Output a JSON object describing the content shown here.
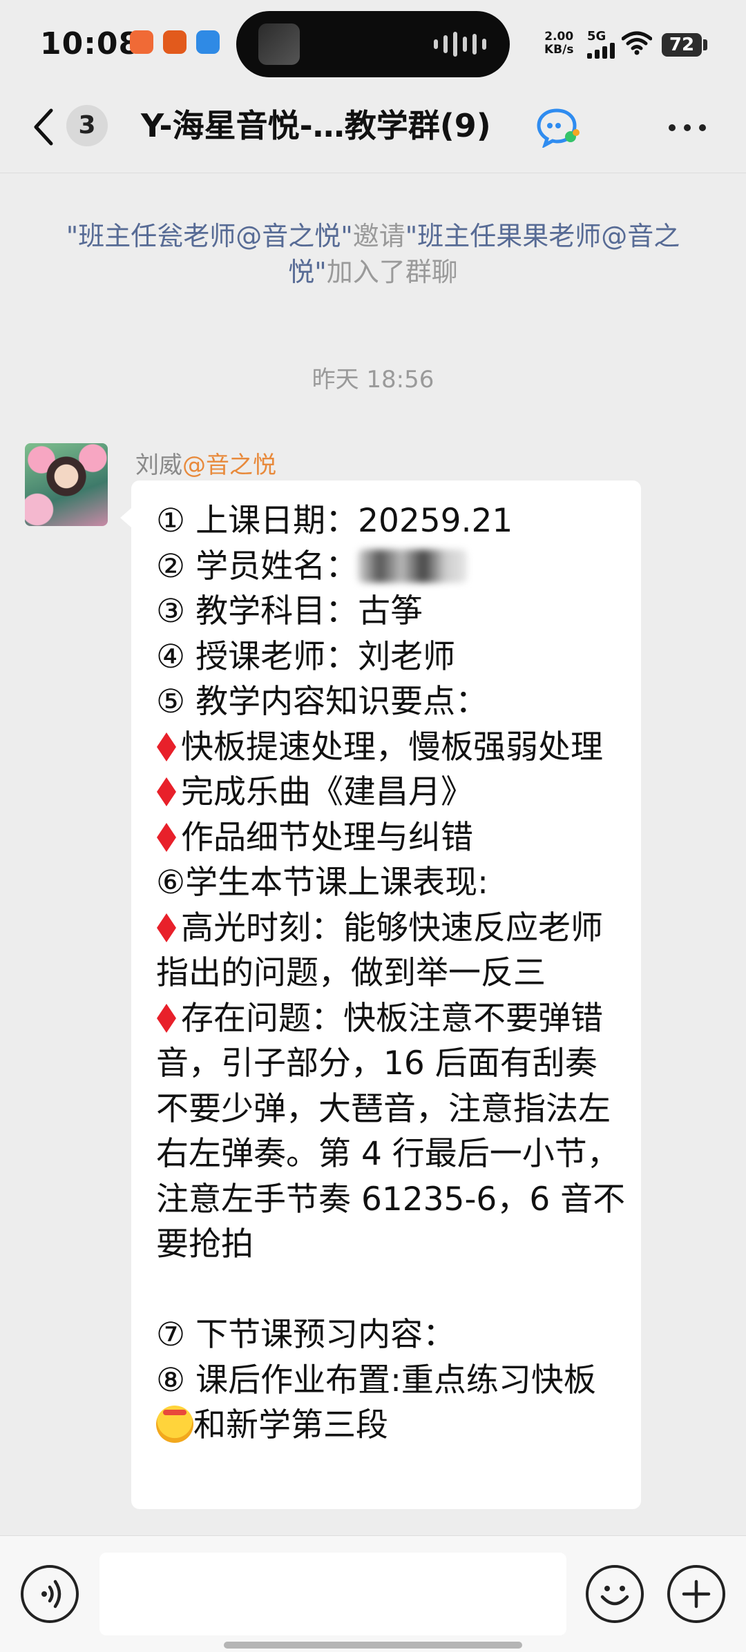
{
  "status_bar": {
    "time": "10:08",
    "net_speed_value": "2.00",
    "net_speed_unit": "KB/s",
    "network": "5G",
    "battery": "72"
  },
  "nav": {
    "unread_count": "3",
    "title": "Y-海星音悦-…教学群(9)"
  },
  "system": {
    "inviter": "\"班主任瓮老师@音之悦\"",
    "action": "邀请",
    "invitee": "\"班主任果果老师@音之悦\"",
    "suffix": "加入了群聊"
  },
  "timestamp": "昨天 18:56",
  "message": {
    "sender_name": "刘威",
    "sender_org": "@音之悦",
    "lines": [
      "① 上课日期：20259.21",
      "② 学员姓名：",
      "③ 教学科目：古筝",
      "④ 授课老师：刘老师",
      "⑤ 教学内容知识要点：",
      "快板提速处理，慢板强弱处理",
      "完成乐曲《建昌月》",
      "作品细节处理与纠错",
      "⑥学生本节课上课表现:",
      "高光时刻：能够快速反应老师指出的问题，做到举一反三",
      "存在问题：快板注意不要弹错音，引子部分，16 后面有刮奏不要少弹，大琶音，注意指法左右左弹奏。第 4 行最后一小节，注意左手节奏 61235-6，6 音不要抢拍",
      "",
      "⑦ 下节课预习内容：",
      "⑧ 课后作业布置:重点练习快板",
      "和新学第三段"
    ]
  },
  "colors": {
    "background": "#ededed",
    "bubble": "#ffffff",
    "link": "#576b95",
    "org": "#e88a3c",
    "diamond": "#e8202a"
  },
  "icons": [
    "back-icon",
    "group-chat-icon",
    "more-icon",
    "voice-icon",
    "emoji-icon",
    "plus-icon",
    "wifi-icon",
    "signal-icon",
    "battery-icon"
  ]
}
